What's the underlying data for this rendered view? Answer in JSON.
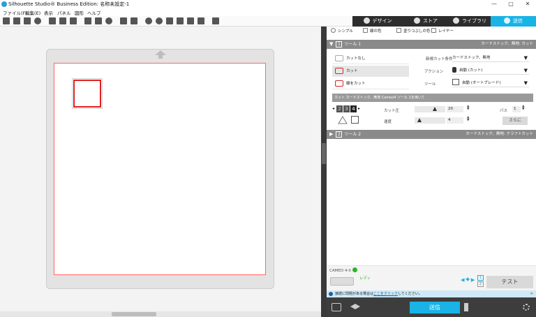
{
  "window": {
    "title": "Silhouette Studio® Business Edition: 名称未設定-1",
    "minimize": "—",
    "maximize": "▢",
    "close": "✕"
  },
  "menu": [
    "ファイル(F)",
    "編集(E)",
    "表示",
    "パネル",
    "図形",
    "ヘルプ"
  ],
  "top_tabs": [
    {
      "label": "デザイン",
      "active": false
    },
    {
      "label": "ストア",
      "active": false
    },
    {
      "label": "ライブラリ",
      "active": false
    },
    {
      "label": "送信",
      "active": true
    }
  ],
  "colors": {
    "accent": "#19b3e6",
    "tab_bg": "#2d2d2d",
    "tab_active": "#19b3e6",
    "cut_red": "#e02020",
    "ready_green": "#2ab52a"
  },
  "send_panel": {
    "subtabs": [
      "シンプル",
      "線の色",
      "塗りつぶしの色",
      "レイヤー"
    ],
    "tool1": {
      "num": "1",
      "label": "ツール 1",
      "material": "カードストック、無地: カット"
    },
    "cut_options": [
      "カットなし",
      "カット",
      "線をカット"
    ],
    "new_cut_condition_label": "新規カット条件",
    "new_cut_condition_value": "カードストック、無地",
    "action_label": "アクション",
    "action_value": "自動 (カット)",
    "tool_label": "ツール",
    "tool_value": "自動 (オートブレード)",
    "info_bar": "カット カードストック、無地 Cameo4 ツール 1を用いて",
    "blade_digits": [
      "2",
      "3",
      "4"
    ],
    "cut_pressure_label": "カット圧",
    "cut_pressure_value": "20",
    "speed_label": "速度",
    "speed_value": "4",
    "pass_label": "パス",
    "pass_value": "1",
    "more_button": "さらに",
    "tool2": {
      "num": "2",
      "label": "ツール 2",
      "material": "カードストック、無地: クラフトカット"
    },
    "device": {
      "model": "CAMEO 4-0",
      "status": "レディ",
      "tool_nums": [
        "1",
        "2"
      ],
      "test_button": "テスト"
    },
    "warning_prefix": "接続に問題がある場合は",
    "warning_link": "ここをクリック",
    "warning_suffix": "してください。",
    "send_button": "送信"
  }
}
